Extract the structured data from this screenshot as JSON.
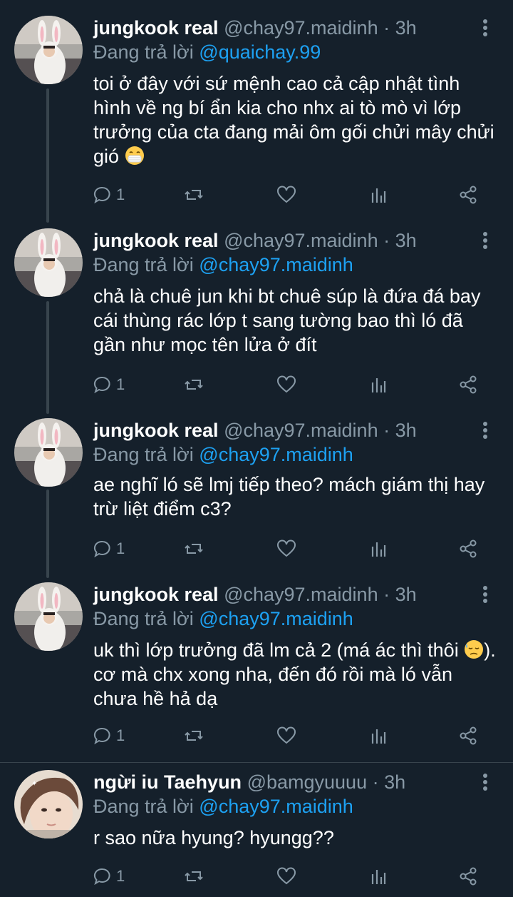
{
  "replying_label": "Đang trả lời",
  "tweets": [
    {
      "name": "jungkook real",
      "handle": "@chay97.maidinh · 3h",
      "reply_to": "@quaichay.99",
      "text": "toi ở đây với sứ mệnh cao cả cập nhật tình hình về ng bí ẩn kia cho nhx ai tò mò vì lớp trưởng của cta đang mải ôm gối chửi mây chửi gió ",
      "reply_count": "1",
      "avatar": "bunny-avatar",
      "emoji": "mask-face"
    },
    {
      "name": "jungkook real",
      "handle": "@chay97.maidinh · 3h",
      "reply_to": "@chay97.maidinh",
      "text": "chả là chuê jun khi bt chuê súp là đứa đá bay cái thùng rác lớp t sang tường bao thì ló đã gần như mọc tên lửa ở đít",
      "reply_count": "1",
      "avatar": "bunny-avatar"
    },
    {
      "name": "jungkook real",
      "handle": "@chay97.maidinh · 3h",
      "reply_to": "@chay97.maidinh",
      "text": "ae nghĩ ló sẽ lmj tiếp theo? mách giám thị hay trừ liệt điểm c3?",
      "reply_count": "1",
      "avatar": "bunny-avatar"
    },
    {
      "name": "jungkook real",
      "handle": "@chay97.maidinh · 3h",
      "reply_to": "@chay97.maidinh",
      "text_a": "uk thì lớp trưởng đã lm cả 2 (má ác thì thôi ",
      "text_b": "). cơ mà chx xong nha, đến đó rồi mà ló vẫn chưa hề hả dạ",
      "reply_count": "1",
      "avatar": "bunny-avatar",
      "emoji": "downcast-sweat-face"
    },
    {
      "name": "ngừi iu Taehyun",
      "handle": "@bamgyuuuu · 3h",
      "reply_to": "@chay97.maidinh",
      "text": "r sao nữa hyung? hyungg??",
      "reply_count": "1",
      "avatar": "portrait-avatar"
    }
  ]
}
